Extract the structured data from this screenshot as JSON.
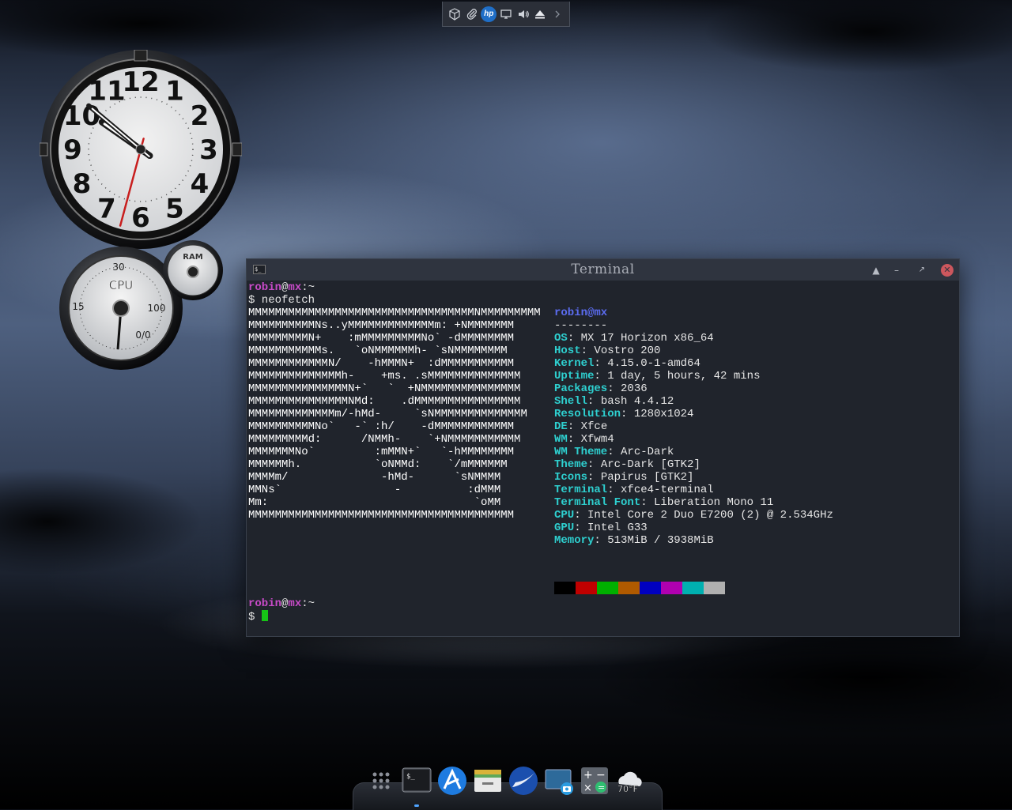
{
  "top_panel": {
    "items": [
      {
        "name": "package-icon"
      },
      {
        "name": "paperclip-icon"
      },
      {
        "name": "hp-logo",
        "label": "hp"
      },
      {
        "name": "display-icon"
      },
      {
        "name": "volume-icon"
      },
      {
        "name": "eject-icon"
      },
      {
        "name": "chevron-right-icon"
      }
    ]
  },
  "clock": {
    "numerals": [
      "12",
      "1",
      "2",
      "3",
      "4",
      "5",
      "6",
      "7",
      "8",
      "9",
      "10",
      "11"
    ],
    "hour_angle": -55,
    "minute_angle": -50,
    "second_angle": 195
  },
  "cpu_gauge": {
    "title": "CPU",
    "scale": [
      "30",
      "15",
      "100"
    ],
    "readout": "0/0"
  },
  "ram_gauge": {
    "title": "RAM"
  },
  "terminal": {
    "title": "Terminal",
    "prompt1": {
      "user": "robin",
      "at": "@",
      "host": "mx",
      "path": ":~"
    },
    "command": "$ neofetch",
    "ascii": [
      "MMMMMMMMMMMMMMMMMMMMMMMMMMMMMMMMMMNMMMMMMMMM",
      "MMMMMMMMMMNs..yMMMMMMMMMMMMMm: +NMMMMMMM",
      "MMMMMMMMMN+    :mMMMMMMMMMNo` -dMMMMMMMM",
      "MMMMMMMMMMMs.   `oNMMMMMMh- `sNMMMMMMMM",
      "MMMMMMMMMMMMN/    -hMMMN+  :dMMMMMMMMMMM",
      "MMMMMMMMMMMMMMh-    +ms. .sMMMMMMMMMMMMMM",
      "MMMMMMMMMMMMMMMN+`   `  +NMMMMMMMMMMMMMMM",
      "MMMMMMMMMMMMMMMNMd:    .dMMMMMMMMMMMMMMMM",
      "MMMMMMMMMMMMMm/-hMd-     `sNMMMMMMMMMMMMMM",
      "MMMMMMMMMMNo`   -` :h/    -dMMMMMMMMMMMM",
      "MMMMMMMMMd:      /NMMh-    `+NMMMMMMMMMMM",
      "MMMMMMMNo`         :mMMN+`   `-hMMMMMMMM",
      "MMMMMMh.           `oNMMd:    `/mMMMMMM",
      "MMMMm/              -hMd-      `sNMMMM",
      "MMNs`                 -          :dMMM",
      "Mm:                               `oMM",
      "MMMMMMMMMMMMMMMMMMMMMMMMMMMMMMMMMMMMMMMM"
    ],
    "info_header": "robin@mx",
    "info_sep": "--------",
    "info": [
      {
        "key": "OS",
        "value": "MX 17 Horizon x86_64"
      },
      {
        "key": "Host",
        "value": "Vostro 200"
      },
      {
        "key": "Kernel",
        "value": "4.15.0-1-amd64"
      },
      {
        "key": "Uptime",
        "value": "1 day, 5 hours, 42 mins"
      },
      {
        "key": "Packages",
        "value": "2036"
      },
      {
        "key": "Shell",
        "value": "bash 4.4.12"
      },
      {
        "key": "Resolution",
        "value": "1280x1024"
      },
      {
        "key": "DE",
        "value": "Xfce"
      },
      {
        "key": "WM",
        "value": "Xfwm4"
      },
      {
        "key": "WM Theme",
        "value": "Arc-Dark"
      },
      {
        "key": "Theme",
        "value": "Arc-Dark [GTK2]"
      },
      {
        "key": "Icons",
        "value": "Papirus [GTK2]"
      },
      {
        "key": "Terminal",
        "value": "xfce4-terminal"
      },
      {
        "key": "Terminal Font",
        "value": "Liberation Mono 11"
      },
      {
        "key": "CPU",
        "value": "Intel Core 2 Duo E7200 (2) @ 2.534GHz"
      },
      {
        "key": "GPU",
        "value": "Intel G33"
      },
      {
        "key": "Memory",
        "value": "513MiB / 3938MiB"
      }
    ],
    "palette": [
      "#000000",
      "#c00000",
      "#00b000",
      "#b05a00",
      "#0000c0",
      "#b000b0",
      "#00b0b0",
      "#b0b0b0"
    ],
    "prompt2": {
      "user": "robin",
      "at": "@",
      "host": "mx",
      "path": ":~"
    },
    "prompt2_symbol": "$ "
  },
  "dock": {
    "items": [
      {
        "name": "app-grid-icon"
      },
      {
        "name": "terminal-app-icon",
        "label": "$_"
      },
      {
        "name": "browser-app-icon"
      },
      {
        "name": "file-manager-icon"
      },
      {
        "name": "seamonkey-icon"
      },
      {
        "name": "screenshot-icon"
      },
      {
        "name": "calculator-icon"
      },
      {
        "name": "weather-icon",
        "label": "70°F"
      }
    ]
  }
}
